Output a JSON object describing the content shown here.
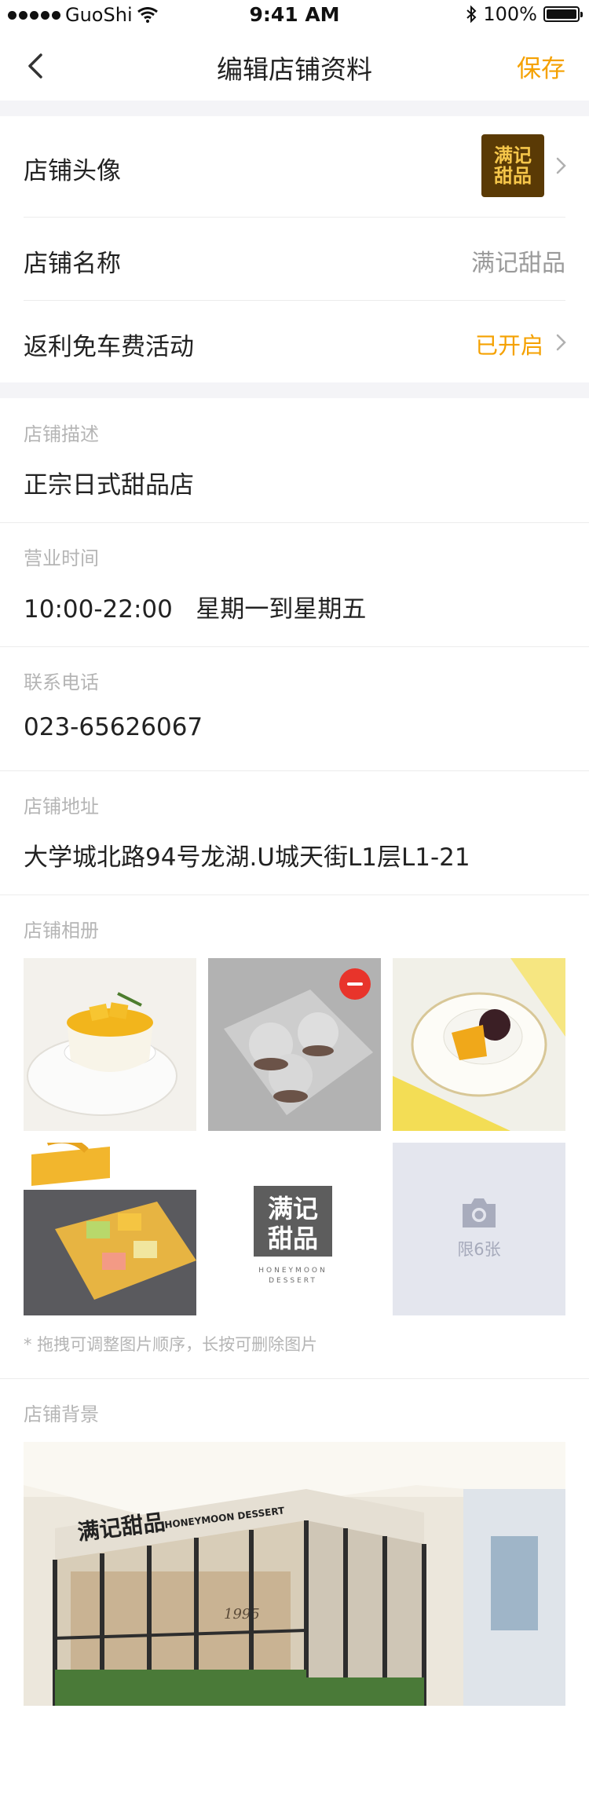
{
  "status_bar": {
    "carrier": "GuoShi",
    "time": "9:41 AM",
    "battery": "100%",
    "battery_level": 1.0
  },
  "nav": {
    "title": "编辑店铺资料",
    "save_label": "保存"
  },
  "basic": {
    "avatar_label": "店铺头像",
    "avatar_logo_line1": "满记",
    "avatar_logo_line2": "甜品",
    "name_label": "店铺名称",
    "name_value": "满记甜品",
    "rebate_label": "返利免车费活动",
    "rebate_value": "已开启"
  },
  "details": {
    "description_label": "店铺描述",
    "description_value": "正宗日式甜品店",
    "hours_label": "营业时间",
    "hours_value": "10:00-22:00   星期一到星期五",
    "phone_label": "联系电话",
    "phone_value": "023-65626067",
    "address_label": "店铺地址",
    "address_value": "大学城北路94号龙湖.U城天街L1层L1-21"
  },
  "album": {
    "label": "店铺相册",
    "logo_line1": "满记",
    "logo_line2": "甜品",
    "logo_sub1": "HONEYMOON",
    "logo_sub2": "DESSERT",
    "add_limit": "限6张",
    "hint": "* 拖拽可调整图片顺序，长按可删除图片"
  },
  "background": {
    "label": "店铺背景",
    "sign_main": "满记甜品",
    "sign_sub": "HONEYMOON DESSERT",
    "sign_year": "1995"
  },
  "colors": {
    "accent": "#f5a100",
    "remove": "#e8342b",
    "band": "#f4f4f7"
  }
}
